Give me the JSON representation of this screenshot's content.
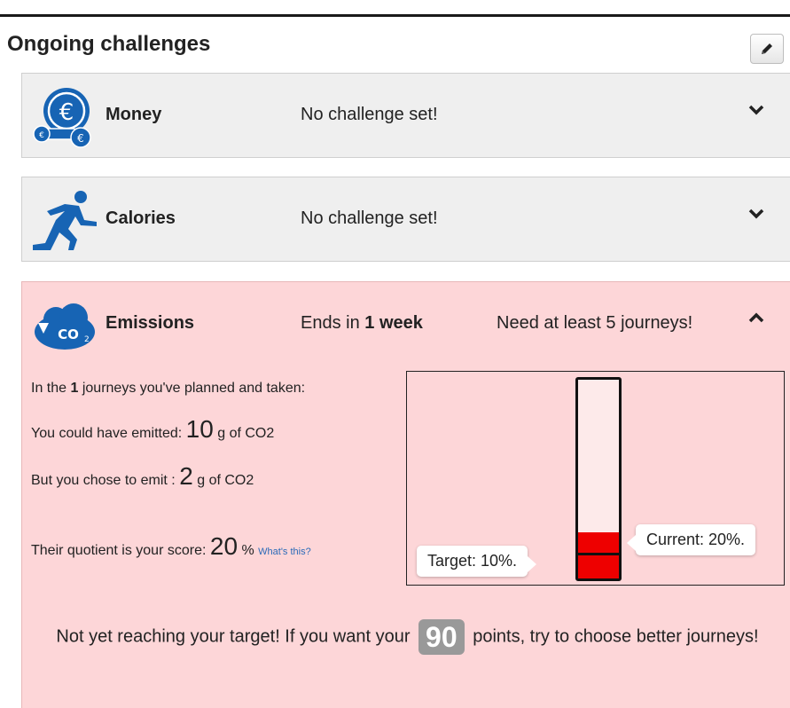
{
  "header": {
    "title": "Ongoing challenges",
    "edit_icon": "pencil-icon"
  },
  "challenges": {
    "money": {
      "name": "Money",
      "status": "No challenge set!",
      "icon": "euro-coins-icon",
      "expand_icon": "chevron-down-icon"
    },
    "calories": {
      "name": "Calories",
      "status": "No challenge set!",
      "icon": "runner-icon",
      "expand_icon": "chevron-down-icon"
    },
    "emissions": {
      "name": "Emissions",
      "status_prefix": "Ends in ",
      "status_bold": "1 week",
      "requirement": "Need at least 5 journeys!",
      "icon": "co2-cloud-icon",
      "collapse_icon": "chevron-up-icon",
      "stats": {
        "journeys_prefix": "In the ",
        "journeys_count": "1",
        "journeys_suffix": " journeys you've planned and taken:",
        "could_emit_prefix": "You could have emitted: ",
        "could_emit_value": "10",
        "could_emit_unit": " g of CO2",
        "chose_emit_prefix": "But you chose to emit : ",
        "chose_emit_value": "2",
        "chose_emit_unit": " g of CO2",
        "score_prefix": "Their quotient is your score: ",
        "score_value": "20",
        "score_unit": " %",
        "whats_this": "What's this?"
      },
      "gauge": {
        "current_fraction": 0.2,
        "target_fraction": 0.1,
        "fill_color": "#ee0000",
        "target_label": "Target: 10%.",
        "current_label": "Current: 20%."
      },
      "message": {
        "before": "Not yet reaching your target! If you want your ",
        "points": "90",
        "after": " points, try to choose better journeys!"
      }
    }
  },
  "colors": {
    "panel_bg": "#efefef",
    "emissions_bg": "#fdd6d8",
    "icon_blue": "#1764b4"
  }
}
